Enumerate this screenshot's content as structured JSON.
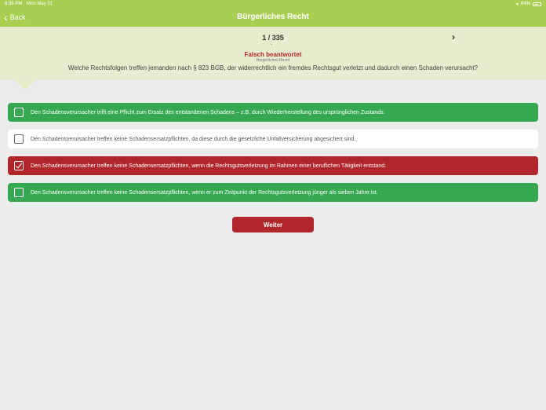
{
  "status_bar": {
    "time": "6:35 PM",
    "date": "Mon May 31",
    "battery": "64%"
  },
  "nav": {
    "back_label": "Back",
    "title": "Bürgerliches Recht"
  },
  "header": {
    "counter": "1 / 335",
    "status": "Falsch beantwortet",
    "category": "Bürgerliches Recht",
    "question": "Welche Rechtsfolgen treffen jemanden nach § 823 BGB, der widerrechtlich ein fremdes Rechtsgut verletzt und dadurch einen Schaden verursacht?"
  },
  "answers": [
    {
      "text": "Den Schadensverursacher trifft eine Pflicht zum Ersatz des entstandenen Schadens – z.B. durch Wiederherstellung des ursprünglichen Zustands.",
      "state": "correct",
      "checked": false
    },
    {
      "text": "Den Schadensverursacher treffen keine Schadensersatzpflichten, da diese durch die gesetzliche Unfallversicherung abgesichert sind.",
      "state": "neutral",
      "checked": false
    },
    {
      "text": "Den Schadensverursacher treffen keine Schadensersatzpflichten, wenn die Rechtsgutsverletzung im Rahmen einer beruflichen Tätigkeit entstand.",
      "state": "wrong",
      "checked": true
    },
    {
      "text": "Den Schadensverursacher treffen keine Schadensersatzpflichten, wenn er zum Zeitpunkt der Rechtsgutsverletzung jünger als sieben Jahre ist.",
      "state": "correct",
      "checked": false
    }
  ],
  "continue_label": "Weiter",
  "colors": {
    "brand": "#a9cf52",
    "correct": "#36a852",
    "wrong": "#b0262a",
    "header_bg": "#e6eccd"
  }
}
